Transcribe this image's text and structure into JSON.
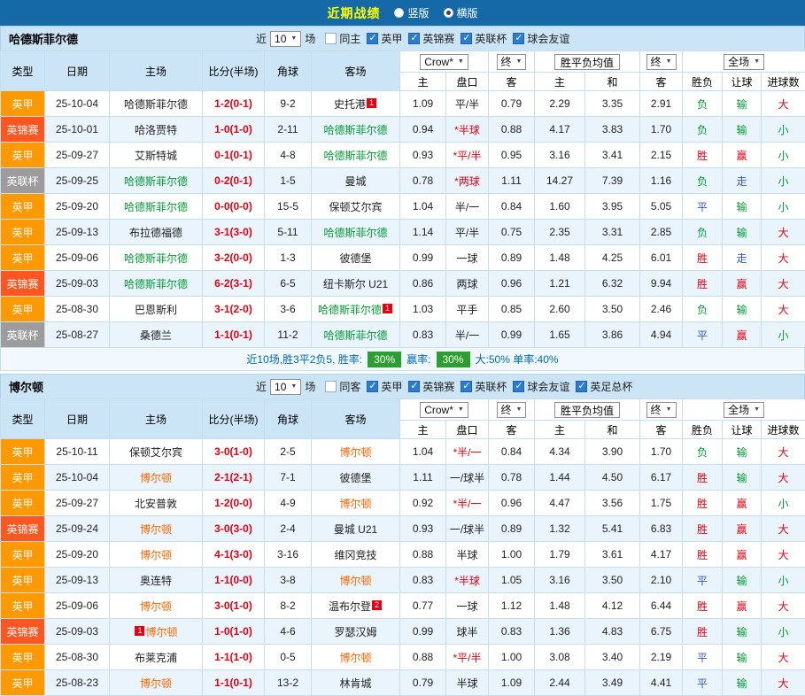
{
  "top_bar": {
    "title": "近期战绩",
    "view_options": [
      {
        "label": "竖版",
        "selected": false
      },
      {
        "label": "横版",
        "selected": true
      }
    ]
  },
  "filter_bar": {
    "near_label": "近",
    "count_value": "10",
    "games_label": "场"
  },
  "table_header": {
    "type": "类型",
    "date": "日期",
    "home": "主场",
    "score": "比分(半场)",
    "corners": "角球",
    "away": "客场",
    "bookmaker_select": "Crow*",
    "final_select": "终",
    "avg_label": "胜平负均值",
    "final_select_2": "终",
    "scope_select": "全场",
    "odds_home": "主",
    "odds_handicap": "盘口",
    "odds_away": "客",
    "avg_home": "主",
    "avg_draw": "和",
    "avg_away": "客",
    "result": "胜负",
    "handicap": "让球",
    "goals": "进球数"
  },
  "colors": {
    "topbar_bg": "#1569a7",
    "header_bg": "#cbe5f6",
    "row_alt_bg": "#e9f4fc",
    "league_england_l1": "#ff9900",
    "league_efl_trophy": "#fe5621",
    "league_efl_cup": "#9c9c9c",
    "team_green": "#009933",
    "team_orange": "#ff6600",
    "text_red": "#e60012",
    "text_green": "#009933",
    "text_blue": "#3355cc",
    "text_black": "#222222",
    "summary_blue": "#0068b7",
    "badge_green": "#2aa12f"
  },
  "sections": [
    {
      "team": "哈德斯菲尔德",
      "checkboxes": [
        {
          "label": "同主",
          "checked": false
        },
        {
          "label": "英甲",
          "checked": true
        },
        {
          "label": "英锦赛",
          "checked": true
        },
        {
          "label": "英联杯",
          "checked": true
        },
        {
          "label": "球会友谊",
          "checked": true
        }
      ],
      "rows": [
        {
          "league": "英甲",
          "date": "25-10-04",
          "home": "哈德斯菲尔德",
          "home_color": "black",
          "score": "1-2(0-1)",
          "corners": "9-2",
          "away": "史托港",
          "away_color": "black",
          "away_badge": "1",
          "odds": [
            "1.09",
            "平/半",
            "0.79"
          ],
          "handicap_red": false,
          "avg": [
            "2.29",
            "3.35",
            "2.91"
          ],
          "result": "负",
          "result_color": "green",
          "handicap_result": "输",
          "handicap_color": "green",
          "goals": "大",
          "goals_color": "red"
        },
        {
          "league": "英锦赛",
          "date": "25-10-01",
          "home": "哈洛贾特",
          "home_color": "black",
          "score": "1-0(1-0)",
          "corners": "2-11",
          "away": "哈德斯菲尔德",
          "away_color": "green",
          "odds": [
            "0.94",
            "*半球",
            "0.88"
          ],
          "handicap_red": true,
          "avg": [
            "4.17",
            "3.83",
            "1.70"
          ],
          "result": "负",
          "result_color": "green",
          "handicap_result": "输",
          "handicap_color": "green",
          "goals": "小",
          "goals_color": "green"
        },
        {
          "league": "英甲",
          "date": "25-09-27",
          "home": "艾斯特城",
          "home_color": "black",
          "score": "0-1(0-1)",
          "corners": "4-8",
          "away": "哈德斯菲尔德",
          "away_color": "green",
          "odds": [
            "0.93",
            "*平/半",
            "0.95"
          ],
          "handicap_red": true,
          "avg": [
            "3.16",
            "3.41",
            "2.15"
          ],
          "result": "胜",
          "result_color": "red",
          "handicap_result": "赢",
          "handicap_color": "red",
          "goals": "小",
          "goals_color": "green"
        },
        {
          "league": "英联杯",
          "date": "25-09-25",
          "home": "哈德斯菲尔德",
          "home_color": "green",
          "score": "0-2(0-1)",
          "corners": "1-5",
          "away": "曼城",
          "away_color": "black",
          "odds": [
            "0.78",
            "*两球",
            "1.11"
          ],
          "handicap_red": true,
          "avg": [
            "14.27",
            "7.39",
            "1.16"
          ],
          "result": "负",
          "result_color": "green",
          "handicap_result": "走",
          "handicap_color": "blue",
          "goals": "小",
          "goals_color": "green"
        },
        {
          "league": "英甲",
          "date": "25-09-20",
          "home": "哈德斯菲尔德",
          "home_color": "green",
          "score": "0-0(0-0)",
          "corners": "15-5",
          "away": "保顿艾尔宾",
          "away_color": "black",
          "odds": [
            "1.04",
            "半/一",
            "0.84"
          ],
          "handicap_red": false,
          "avg": [
            "1.60",
            "3.95",
            "5.05"
          ],
          "result": "平",
          "result_color": "blue",
          "handicap_result": "输",
          "handicap_color": "green",
          "goals": "小",
          "goals_color": "green"
        },
        {
          "league": "英甲",
          "date": "25-09-13",
          "home": "布拉德福德",
          "home_color": "black",
          "score": "3-1(3-0)",
          "corners": "5-11",
          "away": "哈德斯菲尔德",
          "away_color": "green",
          "odds": [
            "1.14",
            "平/半",
            "0.75"
          ],
          "handicap_red": false,
          "avg": [
            "2.35",
            "3.31",
            "2.85"
          ],
          "result": "负",
          "result_color": "green",
          "handicap_result": "输",
          "handicap_color": "green",
          "goals": "大",
          "goals_color": "red"
        },
        {
          "league": "英甲",
          "date": "25-09-06",
          "home": "哈德斯菲尔德",
          "home_color": "green",
          "score": "3-2(0-0)",
          "corners": "1-3",
          "away": "彼德堡",
          "away_color": "black",
          "odds": [
            "0.99",
            "一球",
            "0.89"
          ],
          "handicap_red": false,
          "avg": [
            "1.48",
            "4.25",
            "6.01"
          ],
          "result": "胜",
          "result_color": "red",
          "handicap_result": "走",
          "handicap_color": "blue",
          "goals": "大",
          "goals_color": "red"
        },
        {
          "league": "英锦赛",
          "date": "25-09-03",
          "home": "哈德斯菲尔德",
          "home_color": "green",
          "score": "6-2(3-1)",
          "corners": "6-5",
          "away": "纽卡斯尔 U21",
          "away_color": "black",
          "odds": [
            "0.86",
            "两球",
            "0.96"
          ],
          "handicap_red": false,
          "avg": [
            "1.21",
            "6.32",
            "9.94"
          ],
          "result": "胜",
          "result_color": "red",
          "handicap_result": "赢",
          "handicap_color": "red",
          "goals": "大",
          "goals_color": "red"
        },
        {
          "league": "英甲",
          "date": "25-08-30",
          "home": "巴恩斯利",
          "home_color": "black",
          "score": "3-1(2-0)",
          "corners": "3-6",
          "away": "哈德斯菲尔德",
          "away_color": "green",
          "away_badge": "1",
          "odds": [
            "1.03",
            "平手",
            "0.85"
          ],
          "handicap_red": false,
          "avg": [
            "2.60",
            "3.50",
            "2.46"
          ],
          "result": "负",
          "result_color": "green",
          "handicap_result": "输",
          "handicap_color": "green",
          "goals": "大",
          "goals_color": "red"
        },
        {
          "league": "英联杯",
          "date": "25-08-27",
          "home": "桑德兰",
          "home_color": "black",
          "score": "1-1(0-1)",
          "corners": "11-2",
          "away": "哈德斯菲尔德",
          "away_color": "green",
          "odds": [
            "0.83",
            "半/一",
            "0.99"
          ],
          "handicap_red": false,
          "avg": [
            "1.65",
            "3.86",
            "4.94"
          ],
          "result": "平",
          "result_color": "blue",
          "handicap_result": "赢",
          "handicap_color": "red",
          "goals": "小",
          "goals_color": "green"
        }
      ],
      "summary": {
        "prefix": "近10场,胜3平2负5, 胜率:",
        "win_rate": "30%",
        "mid": "赢率:",
        "handicap_rate": "30%",
        "tail": "大:50% 单率:40%"
      }
    },
    {
      "team": "博尔顿",
      "checkboxes": [
        {
          "label": "同客",
          "checked": false
        },
        {
          "label": "英甲",
          "checked": true
        },
        {
          "label": "英锦赛",
          "checked": true
        },
        {
          "label": "英联杯",
          "checked": true
        },
        {
          "label": "球会友谊",
          "checked": true
        },
        {
          "label": "英足总杯",
          "checked": true
        }
      ],
      "rows": [
        {
          "league": "英甲",
          "date": "25-10-11",
          "home": "保顿艾尔宾",
          "home_color": "black",
          "score": "3-0(1-0)",
          "corners": "2-5",
          "away": "博尔顿",
          "away_color": "orange",
          "odds": [
            "1.04",
            "*半/一",
            "0.84"
          ],
          "handicap_red": true,
          "avg": [
            "4.34",
            "3.90",
            "1.70"
          ],
          "result": "负",
          "result_color": "green",
          "handicap_result": "输",
          "handicap_color": "green",
          "goals": "大",
          "goals_color": "red"
        },
        {
          "league": "英甲",
          "date": "25-10-04",
          "home": "博尔顿",
          "home_color": "orange",
          "score": "2-1(2-1)",
          "corners": "7-1",
          "away": "彼德堡",
          "away_color": "black",
          "odds": [
            "1.11",
            "一/球半",
            "0.78"
          ],
          "handicap_red": false,
          "avg": [
            "1.44",
            "4.50",
            "6.17"
          ],
          "result": "胜",
          "result_color": "red",
          "handicap_result": "输",
          "handicap_color": "green",
          "goals": "大",
          "goals_color": "red"
        },
        {
          "league": "英甲",
          "date": "25-09-27",
          "home": "北安普敦",
          "home_color": "black",
          "score": "1-2(0-0)",
          "corners": "4-9",
          "away": "博尔顿",
          "away_color": "orange",
          "odds": [
            "0.92",
            "*半/一",
            "0.96"
          ],
          "handicap_red": true,
          "avg": [
            "4.47",
            "3.56",
            "1.75"
          ],
          "result": "胜",
          "result_color": "red",
          "handicap_result": "赢",
          "handicap_color": "red",
          "goals": "小",
          "goals_color": "green"
        },
        {
          "league": "英锦赛",
          "date": "25-09-24",
          "home": "博尔顿",
          "home_color": "orange",
          "score": "3-0(3-0)",
          "corners": "2-4",
          "away": "曼城 U21",
          "away_color": "black",
          "odds": [
            "0.93",
            "一/球半",
            "0.89"
          ],
          "handicap_red": false,
          "avg": [
            "1.32",
            "5.41",
            "6.83"
          ],
          "result": "胜",
          "result_color": "red",
          "handicap_result": "赢",
          "handicap_color": "red",
          "goals": "大",
          "goals_color": "red"
        },
        {
          "league": "英甲",
          "date": "25-09-20",
          "home": "博尔顿",
          "home_color": "orange",
          "score": "4-1(3-0)",
          "corners": "3-16",
          "away": "维冈竞技",
          "away_color": "black",
          "odds": [
            "0.88",
            "半球",
            "1.00"
          ],
          "handicap_red": false,
          "avg": [
            "1.79",
            "3.61",
            "4.17"
          ],
          "result": "胜",
          "result_color": "red",
          "handicap_result": "赢",
          "handicap_color": "red",
          "goals": "大",
          "goals_color": "red"
        },
        {
          "league": "英甲",
          "date": "25-09-13",
          "home": "奥连特",
          "home_color": "black",
          "score": "1-1(0-0)",
          "corners": "3-8",
          "away": "博尔顿",
          "away_color": "orange",
          "odds": [
            "0.83",
            "*半球",
            "1.05"
          ],
          "handicap_red": true,
          "avg": [
            "3.16",
            "3.50",
            "2.10"
          ],
          "result": "平",
          "result_color": "blue",
          "handicap_result": "输",
          "handicap_color": "green",
          "goals": "小",
          "goals_color": "green"
        },
        {
          "league": "英甲",
          "date": "25-09-06",
          "home": "博尔顿",
          "home_color": "orange",
          "score": "3-0(1-0)",
          "corners": "8-2",
          "away": "温布尔登",
          "away_color": "black",
          "away_badge": "2",
          "odds": [
            "0.77",
            "一球",
            "1.12"
          ],
          "handicap_red": false,
          "avg": [
            "1.48",
            "4.12",
            "6.44"
          ],
          "result": "胜",
          "result_color": "red",
          "handicap_result": "赢",
          "handicap_color": "red",
          "goals": "大",
          "goals_color": "red"
        },
        {
          "league": "英锦赛",
          "date": "25-09-03",
          "home": "博尔顿",
          "home_color": "orange",
          "home_badge_before": "1",
          "score": "1-0(1-0)",
          "corners": "4-6",
          "away": "罗瑟汉姆",
          "away_color": "black",
          "odds": [
            "0.99",
            "球半",
            "0.83"
          ],
          "handicap_red": false,
          "avg": [
            "1.36",
            "4.83",
            "6.75"
          ],
          "result": "胜",
          "result_color": "red",
          "handicap_result": "输",
          "handicap_color": "green",
          "goals": "小",
          "goals_color": "green"
        },
        {
          "league": "英甲",
          "date": "25-08-30",
          "home": "布莱克浦",
          "home_color": "black",
          "score": "1-1(1-0)",
          "corners": "0-5",
          "away": "博尔顿",
          "away_color": "orange",
          "odds": [
            "0.88",
            "*平/半",
            "1.00"
          ],
          "handicap_red": true,
          "avg": [
            "3.08",
            "3.40",
            "2.19"
          ],
          "result": "平",
          "result_color": "blue",
          "handicap_result": "输",
          "handicap_color": "green",
          "goals": "大",
          "goals_color": "red"
        },
        {
          "league": "英甲",
          "date": "25-08-23",
          "home": "博尔顿",
          "home_color": "orange",
          "score": "1-1(0-1)",
          "corners": "13-2",
          "away": "林肯城",
          "away_color": "black",
          "odds": [
            "0.79",
            "半球",
            "1.09"
          ],
          "handicap_red": false,
          "avg": [
            "2.44",
            "3.49",
            "4.41"
          ],
          "result": "平",
          "result_color": "blue",
          "handicap_result": "输",
          "handicap_color": "green",
          "goals": "大",
          "goals_color": "red"
        }
      ]
    }
  ]
}
